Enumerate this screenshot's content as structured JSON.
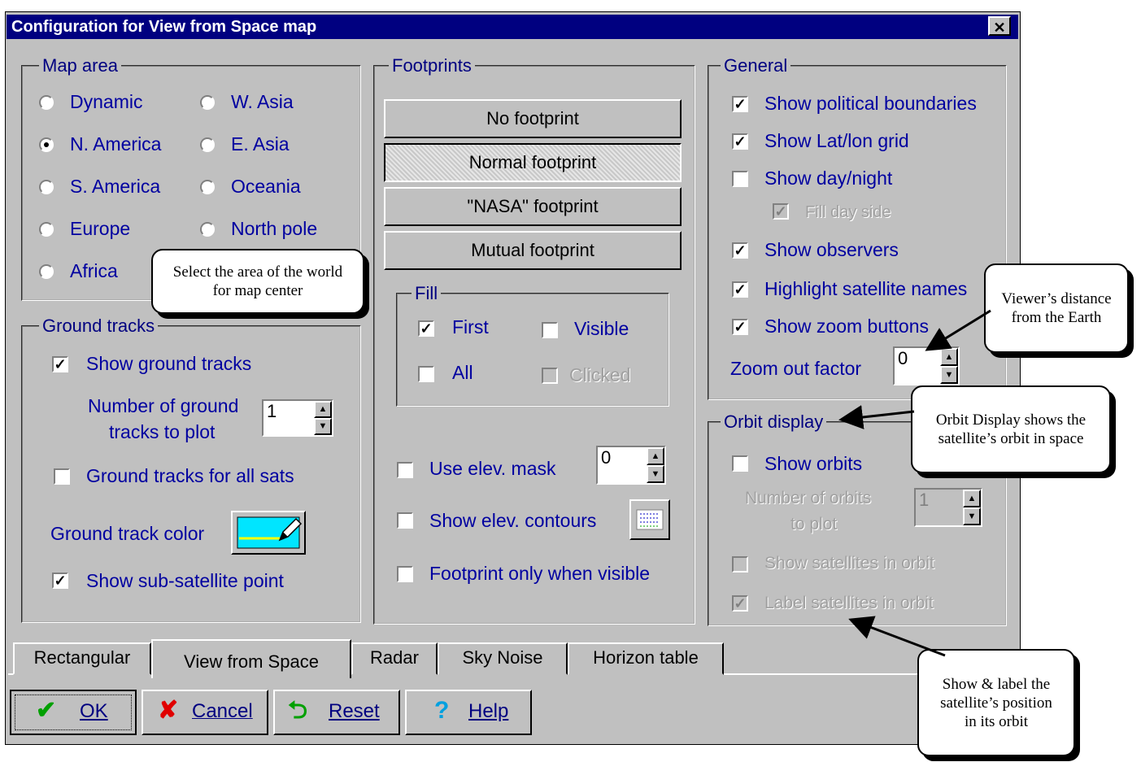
{
  "window": {
    "title": "Configuration for View from Space  map",
    "close": "✕"
  },
  "map_area": {
    "title": "Map area",
    "options": [
      {
        "label": "Dynamic",
        "checked": false
      },
      {
        "label": "W. Asia",
        "checked": false
      },
      {
        "label": "N. America",
        "checked": true
      },
      {
        "label": "E. Asia",
        "checked": false
      },
      {
        "label": "S. America",
        "checked": false
      },
      {
        "label": "Oceania",
        "checked": false
      },
      {
        "label": "Europe",
        "checked": false
      },
      {
        "label": "North pole",
        "checked": false
      },
      {
        "label": "Africa",
        "checked": false
      }
    ]
  },
  "ground_tracks": {
    "title": "Ground tracks",
    "show_ground_tracks": "Show ground tracks",
    "number_label_1": "Number of ground",
    "number_label_2": "tracks to plot",
    "number_value": "1",
    "all_sats": "Ground tracks for all sats",
    "color_label": "Ground track color",
    "sub_satellite": "Show sub-satellite point"
  },
  "footprints": {
    "title": "Footprints",
    "buttons": [
      "No footprint",
      "Normal footprint",
      "\"NASA\" footprint",
      "Mutual footprint"
    ],
    "fill": {
      "title": "Fill",
      "first": "First",
      "visible": "Visible",
      "all": "All",
      "clicked": "Clicked"
    },
    "elev_mask": "Use elev. mask",
    "elev_mask_value": "0",
    "elev_contours": "Show elev. contours",
    "only_visible": "Footprint only when visible"
  },
  "general": {
    "title": "General",
    "political": "Show political boundaries",
    "latlon": "Show Lat/lon grid",
    "daynight": "Show day/night",
    "fillday": "Fill day side",
    "observers": "Show observers",
    "highlight": "Highlight satellite names",
    "zoom_buttons": "Show zoom buttons",
    "zoom_factor_label": "Zoom out factor",
    "zoom_factor_value": "0"
  },
  "orbit_display": {
    "title": "Orbit display",
    "show_orbits": "Show orbits",
    "num_label_1": "Number of orbits",
    "num_label_2": "to plot",
    "num_value": "1",
    "show_sats": "Show satellites in orbit",
    "label_sats": "Label satellites in orbit"
  },
  "tabs": [
    "Rectangular",
    "View from Space",
    "Radar",
    "Sky Noise",
    "Horizon table"
  ],
  "bottom_buttons": {
    "ok": "OK",
    "cancel": "Cancel",
    "reset": "Reset",
    "help": "Help"
  },
  "callouts": {
    "map_center": "Select the area of the world for map center",
    "viewer_distance": "Viewer’s distance from the Earth",
    "orbit_display": "Orbit Display shows the satellite’s orbit in space",
    "show_label": "Show & label the satellite’s position in its orbit"
  }
}
